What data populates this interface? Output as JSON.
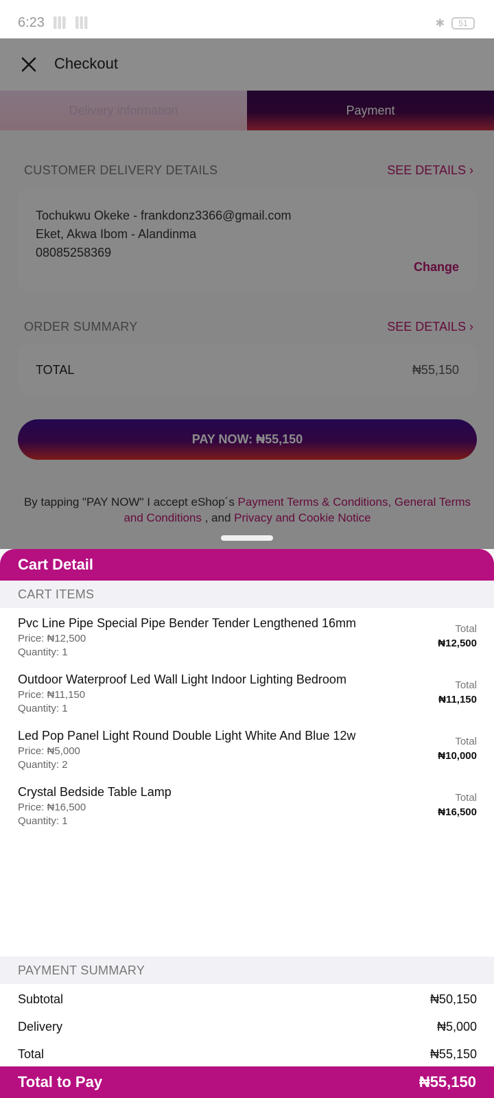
{
  "status_bar": {
    "time": "6:23",
    "battery": "51"
  },
  "header": {
    "title": "Checkout",
    "close_icon": "close-icon"
  },
  "tabs": [
    {
      "label": "Delivery information",
      "active": false
    },
    {
      "label": "Payment",
      "active": true
    }
  ],
  "customer": {
    "section_label": "CUSTOMER DELIVERY DETAILS",
    "see_details": "SEE DETAILS",
    "line1": "Tochukwu Okeke - frankdonz3366@gmail.com",
    "line2": "Eket, Akwa Ibom - Alandinma",
    "line3": "08085258369",
    "change_label": "Change"
  },
  "order_summary": {
    "section_label": "ORDER SUMMARY",
    "see_details": "SEE DETAILS",
    "total_label": "TOTAL",
    "total_value": "₦55,150"
  },
  "pay_button": {
    "label": "PAY NOW: ₦55,150"
  },
  "terms": {
    "prefix": "By tapping \"PAY NOW\" I accept eShop´s ",
    "link1": "Payment Terms & Conditions, General Terms and Conditions",
    "middle": " , and ",
    "link2": "Privacy and Cookie Notice"
  },
  "cart": {
    "title": "Cart Detail",
    "items_label": "CART ITEMS",
    "items": [
      {
        "name": "Pvc Line Pipe Special Pipe Bender Tender Lengthened 16mm",
        "price": "Price: ₦12,500",
        "quantity": "Quantity: 1",
        "total_label": "Total",
        "total": "₦12,500"
      },
      {
        "name": "Outdoor Waterproof Led Wall Light Indoor Lighting Bedroom",
        "price": "Price: ₦11,150",
        "quantity": "Quantity: 1",
        "total_label": "Total",
        "total": "₦11,150"
      },
      {
        "name": "Led Pop Panel Light Round Double Light White And Blue 12w",
        "price": "Price: ₦5,000",
        "quantity": "Quantity: 2",
        "total_label": "Total",
        "total": "₦10,000"
      },
      {
        "name": "Crystal Bedside Table Lamp",
        "price": "Price: ₦16,500",
        "quantity": "Quantity: 1",
        "total_label": "Total",
        "total": "₦16,500"
      }
    ],
    "payment_summary_label": "PAYMENT SUMMARY",
    "subtotal_label": "Subtotal",
    "subtotal_value": "₦50,150",
    "delivery_label": "Delivery",
    "delivery_value": "₦5,000",
    "total_label": "Total",
    "total_value": "₦55,150",
    "total_to_pay_label": "Total to Pay",
    "total_to_pay_value": "₦55,150"
  },
  "colors": {
    "accent": "#b50f80",
    "link": "#b5166e"
  }
}
